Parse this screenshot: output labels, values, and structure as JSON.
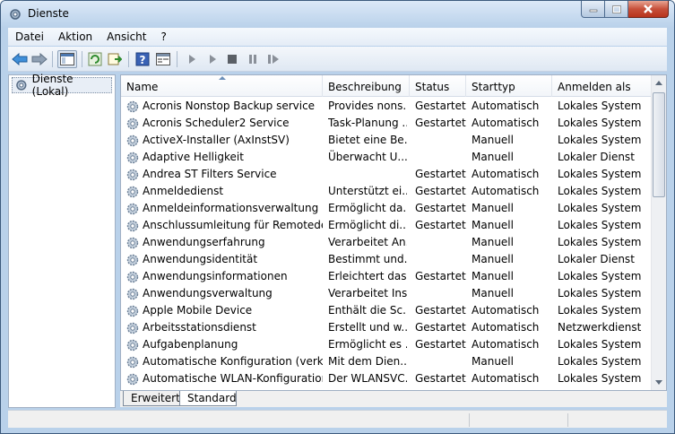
{
  "window": {
    "title": "Dienste"
  },
  "menu": [
    "Datei",
    "Aktion",
    "Ansicht",
    "?"
  ],
  "toolbar": {
    "buttons": [
      "back-arrow-icon",
      "forward-arrow-icon",
      "console-tree-icon",
      "refresh-icon",
      "export-list-icon",
      "help-icon",
      "properties-icon",
      "start-service-icon",
      "start-service-2-icon",
      "stop-service-icon",
      "pause-service-icon",
      "restart-service-icon"
    ]
  },
  "tree": {
    "root": "Dienste (Lokal)"
  },
  "list": {
    "columns": [
      "Name",
      "Beschreibung",
      "Status",
      "Starttyp",
      "Anmelden als"
    ],
    "rows": [
      {
        "name": "Acronis Nonstop Backup service",
        "desc": "Provides nons...",
        "status": "Gestartet",
        "start": "Automatisch",
        "login": "Lokales System"
      },
      {
        "name": "Acronis Scheduler2 Service",
        "desc": "Task-Planung ...",
        "status": "Gestartet",
        "start": "Automatisch",
        "login": "Lokales System"
      },
      {
        "name": "ActiveX-Installer (AxInstSV)",
        "desc": "Bietet eine Be...",
        "status": "",
        "start": "Manuell",
        "login": "Lokales System"
      },
      {
        "name": "Adaptive Helligkeit",
        "desc": "Überwacht U...",
        "status": "",
        "start": "Manuell",
        "login": "Lokaler Dienst"
      },
      {
        "name": "Andrea ST Filters Service",
        "desc": "",
        "status": "Gestartet",
        "start": "Automatisch",
        "login": "Lokales System"
      },
      {
        "name": "Anmeldedienst",
        "desc": "Unterstützt ei...",
        "status": "Gestartet",
        "start": "Automatisch",
        "login": "Lokales System"
      },
      {
        "name": "Anmeldeinformationsverwaltung",
        "desc": "Ermöglicht da...",
        "status": "Gestartet",
        "start": "Manuell",
        "login": "Lokales System"
      },
      {
        "name": "Anschlussumleitung für Remotedes...",
        "desc": "Ermöglicht di...",
        "status": "Gestartet",
        "start": "Manuell",
        "login": "Lokales System"
      },
      {
        "name": "Anwendungserfahrung",
        "desc": "Verarbeitet An...",
        "status": "",
        "start": "Manuell",
        "login": "Lokales System"
      },
      {
        "name": "Anwendungsidentität",
        "desc": "Bestimmt und...",
        "status": "",
        "start": "Manuell",
        "login": "Lokaler Dienst"
      },
      {
        "name": "Anwendungsinformationen",
        "desc": "Erleichtert das...",
        "status": "Gestartet",
        "start": "Manuell",
        "login": "Lokales System"
      },
      {
        "name": "Anwendungsverwaltung",
        "desc": "Verarbeitet Ins...",
        "status": "",
        "start": "Manuell",
        "login": "Lokales System"
      },
      {
        "name": "Apple Mobile Device",
        "desc": "Enthält die Sc...",
        "status": "Gestartet",
        "start": "Automatisch",
        "login": "Lokales System"
      },
      {
        "name": "Arbeitsstationsdienst",
        "desc": "Erstellt und w...",
        "status": "Gestartet",
        "start": "Automatisch",
        "login": "Netzwerkdienst"
      },
      {
        "name": "Aufgabenplanung",
        "desc": "Ermöglicht es ...",
        "status": "Gestartet",
        "start": "Automatisch",
        "login": "Lokales System"
      },
      {
        "name": "Automatische Konfiguration (verka...",
        "desc": "Mit dem Dien...",
        "status": "",
        "start": "Manuell",
        "login": "Lokales System"
      },
      {
        "name": "Automatische WLAN-Konfiguration",
        "desc": "Der WLANSVC...",
        "status": "Gestartet",
        "start": "Automatisch",
        "login": "Lokales System"
      }
    ]
  },
  "tabs": [
    "Erweitert",
    "Standard"
  ]
}
